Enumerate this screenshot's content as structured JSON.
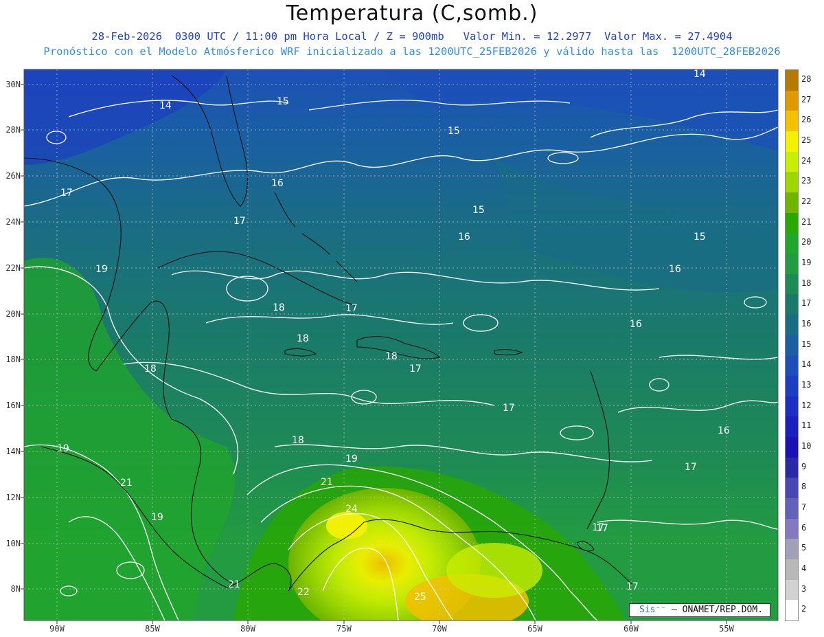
{
  "title": "Temperatura (C,somb.)",
  "subtitle_1": "28-Feb-2026  0300 UTC / 11:00 pm Hora Local / Z = 900mb   Valor Min. = 12.2977  Valor Max. = 27.4904",
  "subtitle_2": "Pronóstico con el Modelo Atmósferico WRF inicializado a las 1200UTC_25FEB2026 y válido hasta las  1200UTC_28FEB2026",
  "credit": {
    "brand": "Sis",
    "text": "– ONAMET/REP.DOM."
  },
  "latitude_labels": [
    "30N",
    "28N",
    "26N",
    "24N",
    "22N",
    "20N",
    "18N",
    "16N",
    "14N",
    "12N",
    "10N",
    "8N"
  ],
  "longitude_labels": [
    "90W",
    "85W",
    "80W",
    "75W",
    "70W",
    "65W",
    "60W",
    "55W"
  ],
  "contour_labels": [
    "14",
    "15",
    "15",
    "16",
    "15",
    "14",
    "17",
    "17",
    "16",
    "15",
    "16",
    "19",
    "18",
    "17",
    "18",
    "16",
    "18",
    "18",
    "17",
    "17",
    "18",
    "17",
    "16",
    "19",
    "21",
    "19",
    "21",
    "17",
    "24",
    "22",
    "21",
    "25",
    "17",
    "19",
    "17"
  ],
  "colorbar": {
    "levels": [
      "28",
      "27",
      "26",
      "25",
      "24",
      "23",
      "22",
      "21",
      "20",
      "19",
      "18",
      "17",
      "16",
      "15",
      "14",
      "13",
      "12",
      "11",
      "10",
      "9",
      "8",
      "7",
      "6",
      "5",
      "4",
      "3",
      "2"
    ],
    "colors": {
      "28": "#b67a00",
      "27": "#e09a00",
      "26": "#f5c000",
      "25": "#f2f200",
      "24": "#c9ee00",
      "23": "#9ed600",
      "22": "#6fb400",
      "21": "#28a800",
      "20": "#20a62a",
      "19": "#229b41",
      "18": "#1e8a55",
      "17": "#1a7a6a",
      "16": "#1a6c84",
      "15": "#1a5fa3",
      "14": "#1c50b8",
      "13": "#1d3fbf",
      "12": "#1d2fc2",
      "11": "#1a1fbd",
      "10": "#1a12b3",
      "9": "#2a2aa6",
      "8": "#4848b2",
      "7": "#6262b8",
      "6": "#8478c0",
      "5": "#a0a0b8",
      "4": "#b8b8b8",
      "3": "#d2d2d2",
      "2": "#ffffff"
    }
  },
  "map_view": {
    "lon_range": [
      -92,
      -52
    ],
    "lat_range": [
      7,
      31
    ],
    "projection": "lat-lon"
  }
}
